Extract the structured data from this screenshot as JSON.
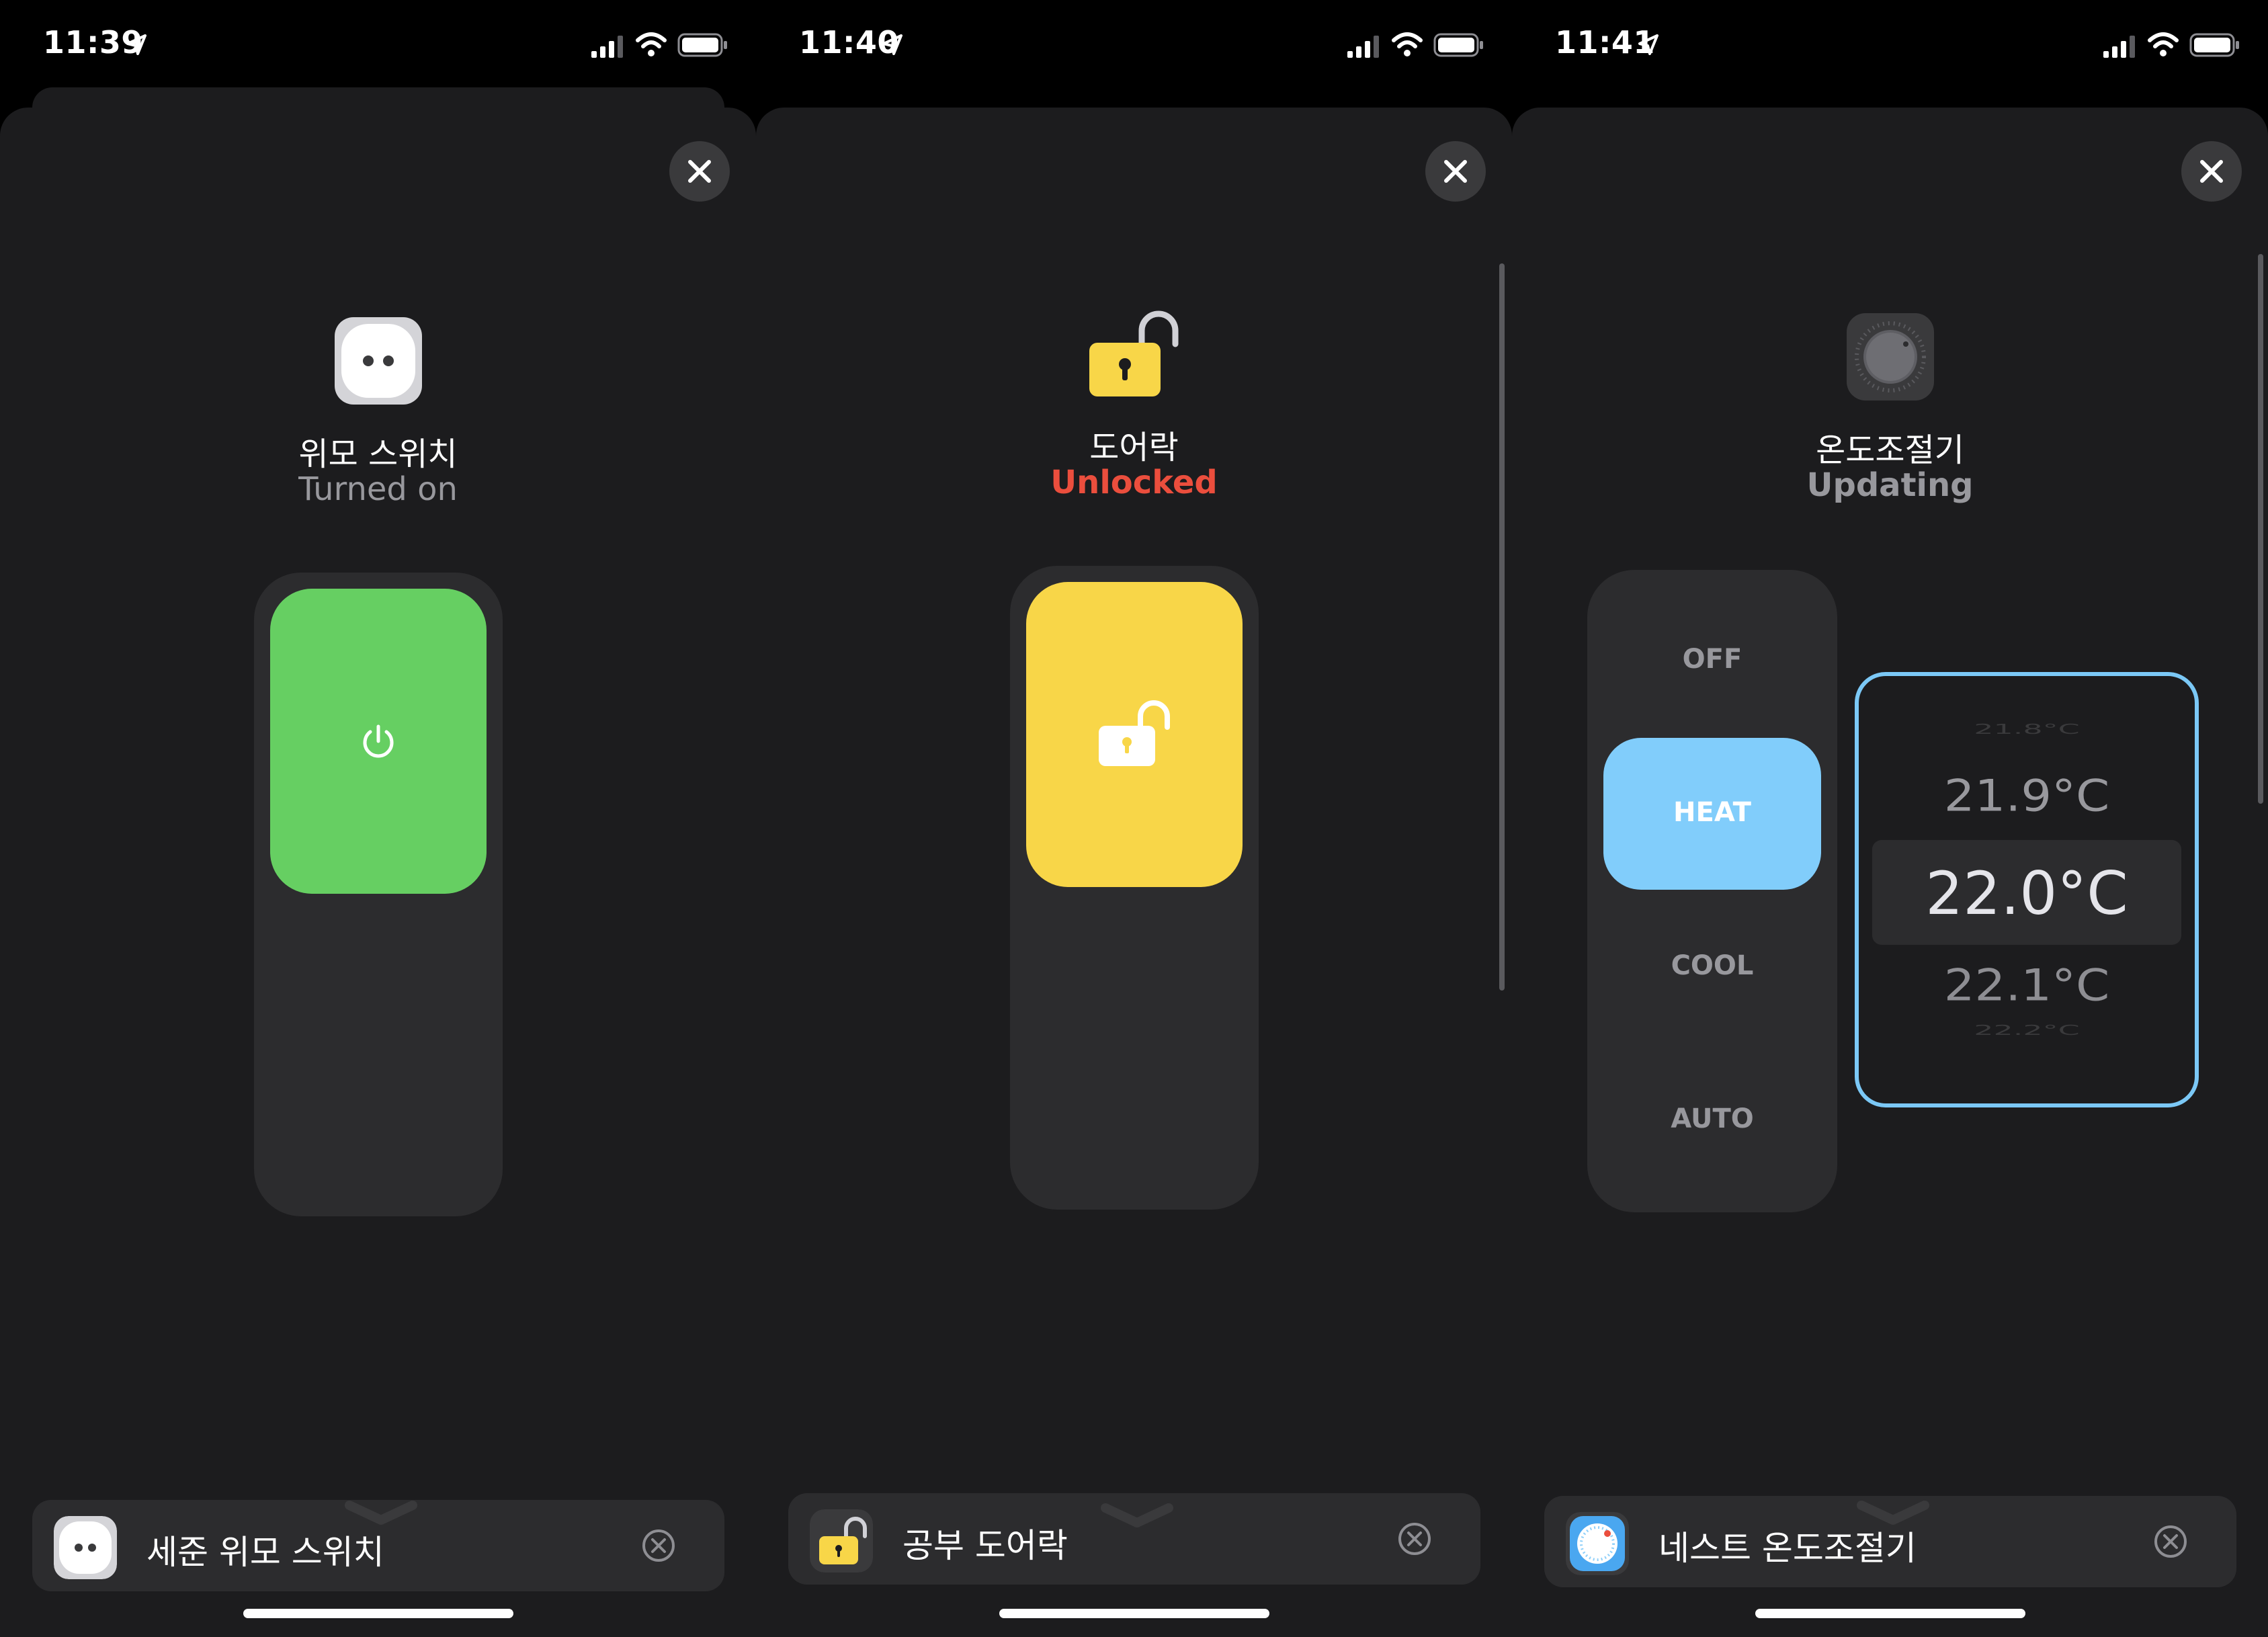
{
  "screens": [
    {
      "time": "11:39",
      "accessory": {
        "name": "위모 스위치",
        "status": "Turned on",
        "status_color": "#98989d",
        "control_color": "#66cf62",
        "icon": "power-outlet-icon",
        "control_icon": "power-icon",
        "level_percent": 100
      },
      "bottom_bar": {
        "label": "세준 위모 스위치",
        "icon": "power-outlet-icon"
      }
    },
    {
      "time": "11:40",
      "accessory": {
        "name": "도어락",
        "status": "Unlocked",
        "status_color": "#eb4e3d",
        "control_color": "#f8d648",
        "icon": "unlocked-padlock-icon",
        "control_icon": "unlocked-padlock-icon",
        "level_percent": 100
      },
      "bottom_bar": {
        "label": "공부 도어락",
        "icon": "unlocked-padlock-icon"
      }
    },
    {
      "time": "11:41",
      "accessory": {
        "name": "온도조절기",
        "status": "Updating",
        "status_color": "#98989d",
        "icon": "thermostat-dial-icon"
      },
      "modes": [
        "OFF",
        "HEAT",
        "COOL",
        "AUTO"
      ],
      "selected_mode": "HEAT",
      "temps": [
        "21.8°C",
        "21.9°C",
        "22.0°C",
        "22.1°C",
        "22.2°C"
      ],
      "selected_temp": "22.0°C",
      "accent_color": "#81cdfb",
      "bottom_bar": {
        "label": "네스트 온도조절기",
        "icon": "nest-app-icon"
      }
    }
  ]
}
